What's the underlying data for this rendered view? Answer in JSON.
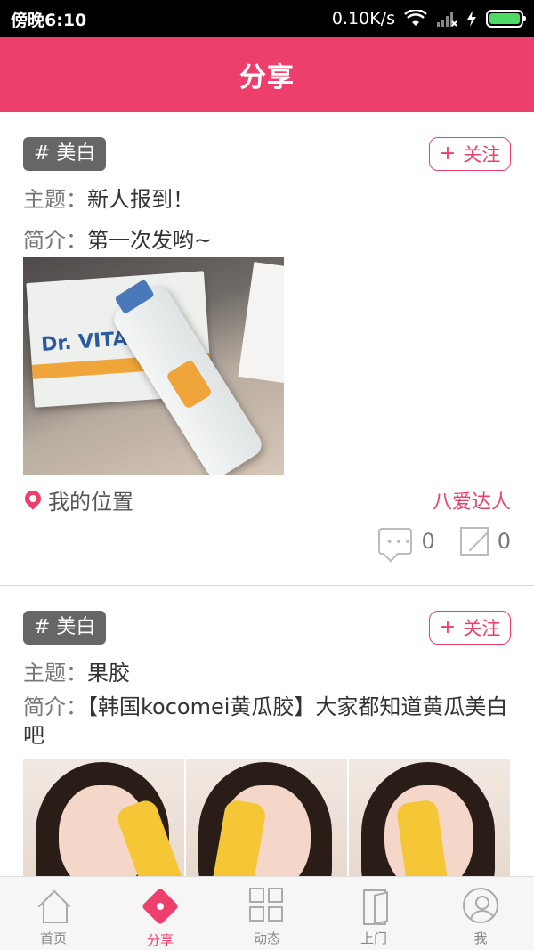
{
  "status_bar": {
    "time": "傍晚6:10",
    "network_speed": "0.10K/s",
    "icons": [
      "wifi-icon",
      "signal-icon",
      "charging-icon",
      "battery-icon"
    ]
  },
  "header": {
    "title": "分享"
  },
  "posts": [
    {
      "tag": "# 美白",
      "follow_label": "关注",
      "topic_key": "主题：",
      "topic_value": "新人报到！",
      "intro_key": "简介：",
      "intro_value": "第一次发哟~",
      "location": "我的位置",
      "author": "八爱达人",
      "comment_count": "0",
      "share_count": "0"
    },
    {
      "tag": "# 美白",
      "follow_label": "关注",
      "topic_key": "主题：",
      "topic_value": "果胶",
      "intro_key": "简介：",
      "intro_value": "【韩国kocomei黄瓜胶】大家都知道黄瓜美白吧"
    }
  ],
  "photo_text": {
    "brand": "Dr. VITA"
  },
  "bottom_nav": {
    "items": [
      {
        "label": "首页",
        "icon": "home-icon"
      },
      {
        "label": "分享",
        "icon": "share-icon",
        "active": true
      },
      {
        "label": "动态",
        "icon": "grid-icon"
      },
      {
        "label": "上门",
        "icon": "door-icon"
      },
      {
        "label": "我",
        "icon": "profile-icon"
      }
    ]
  },
  "colors": {
    "accent": "#ee3e6b",
    "tag_bg": "#666666",
    "status_bar": "#000000"
  }
}
